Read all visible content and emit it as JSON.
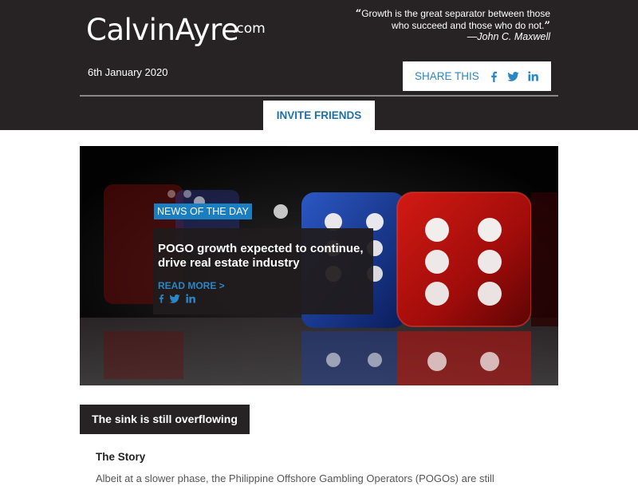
{
  "header": {
    "logo_text": "CalvinAyre",
    "logo_suffix": ".com",
    "quote_open": "“",
    "quote_text": "Growth is the great separator between those who succeed and those who do not.",
    "quote_close": "”",
    "quote_author": "—John C. Maxwell",
    "date": "6th January 2020",
    "share_label": "SHARE THIS",
    "invite_label": "INVITE FRIENDS",
    "icons": [
      "facebook-icon",
      "twitter-icon",
      "linkedin-icon"
    ]
  },
  "hero": {
    "badge": "NEWS OF THE DAY",
    "title": "POGO growth expected to continue, drive real estate industry",
    "read_more": "READ MORE >",
    "image": "red and blue dice on reflective surface"
  },
  "section": {
    "label": "The sink is still overflowing",
    "story_heading": "The Story",
    "story_text": "Albeit at a slower phase, the Philippine Offshore Gambling Operators (POGOs) are still"
  },
  "colors": {
    "dark": "#272324",
    "accent_blue": "#2a86c5",
    "badge_blue": "#1b7ec0",
    "white": "#ffffff"
  }
}
